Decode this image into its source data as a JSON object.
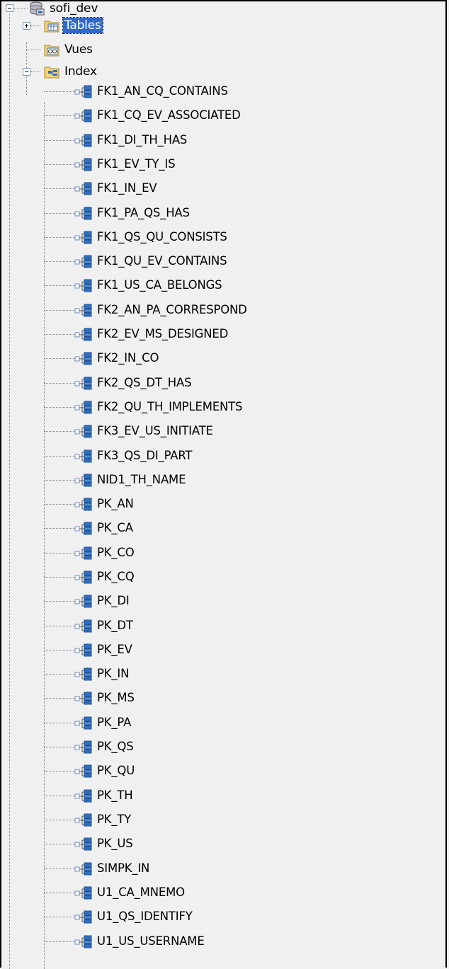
{
  "tree": {
    "root": {
      "label": "sofi_dev",
      "expanded": true,
      "icon": "database-icon"
    },
    "tables": {
      "label": "Tables",
      "expanded": false,
      "selected": true,
      "icon": "folder-table-icon"
    },
    "views": {
      "label": "Vues",
      "icon": "folder-view-icon"
    },
    "index": {
      "label": "Index",
      "expanded": true,
      "icon": "folder-index-icon"
    },
    "index_items": [
      "FK1_AN_CQ_CONTAINS",
      "FK1_CQ_EV_ASSOCIATED",
      "FK1_DI_TH_HAS",
      "FK1_EV_TY_IS",
      "FK1_IN_EV",
      "FK1_PA_QS_HAS",
      "FK1_QS_QU_CONSISTS",
      "FK1_QU_EV_CONTAINS",
      "FK1_US_CA_BELONGS",
      "FK2_AN_PA_CORRESPOND",
      "FK2_EV_MS_DESIGNED",
      "FK2_IN_CO",
      "FK2_QS_DT_HAS",
      "FK2_QU_TH_IMPLEMENTS",
      "FK3_EV_US_INITIATE",
      "FK3_QS_DI_PART",
      "NID1_TH_NAME",
      "PK_AN",
      "PK_CA",
      "PK_CO",
      "PK_CQ",
      "PK_DI",
      "PK_DT",
      "PK_EV",
      "PK_IN",
      "PK_MS",
      "PK_PA",
      "PK_QS",
      "PK_QU",
      "PK_TH",
      "PK_TY",
      "PK_US",
      "SIMPK_IN",
      "U1_CA_MNEMO",
      "U1_QS_IDENTIFY",
      "U1_US_USERNAME"
    ],
    "index_item_icon": "index-icon"
  },
  "colors": {
    "background": "#f0f0f0",
    "selection": "#316ac5",
    "folder": "#f4d27a",
    "index_blue": "#2f6fc0"
  }
}
